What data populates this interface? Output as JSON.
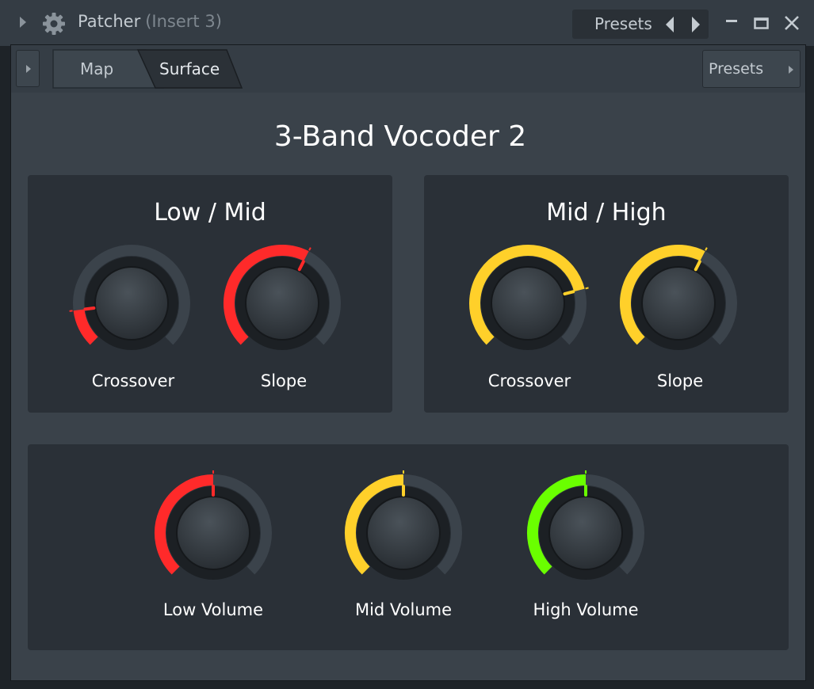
{
  "titlebar": {
    "app_name": "Patcher",
    "insert_label": "(Insert 3)",
    "presets_label": "Presets",
    "icons": {
      "collapse": "triangle-right-icon",
      "gear": "gear-icon",
      "prev": "triangle-left-icon",
      "next": "triangle-right-icon",
      "minimize": "minimize-icon",
      "maximize": "maximize-icon",
      "close": "close-icon"
    }
  },
  "toolbar": {
    "tabs": [
      {
        "label": "Map",
        "active": false
      },
      {
        "label": "Surface",
        "active": true
      }
    ],
    "presets_label": "Presets"
  },
  "surface": {
    "title": "3-Band Vocoder 2",
    "panels": [
      {
        "title": "Low / Mid",
        "color": "#ff2a2a",
        "knobs": [
          {
            "label": "Crossover",
            "value": 0.14
          },
          {
            "label": "Slope",
            "value": 0.6
          }
        ]
      },
      {
        "title": "Mid / High",
        "color": "#ffd02a",
        "knobs": [
          {
            "label": "Crossover",
            "value": 0.78
          },
          {
            "label": "Slope",
            "value": 0.6
          }
        ]
      }
    ],
    "volume": {
      "knobs": [
        {
          "label": "Low Volume",
          "value": 0.5,
          "color": "#ff2a2a"
        },
        {
          "label": "Mid Volume",
          "value": 0.5,
          "color": "#ffd02a"
        },
        {
          "label": "High Volume",
          "value": 0.5,
          "color": "#6aff00"
        }
      ]
    }
  },
  "colors": {
    "background": "#3a424a",
    "panel": "#2a3037",
    "track": "#3b434b",
    "text": "#ffffff"
  }
}
